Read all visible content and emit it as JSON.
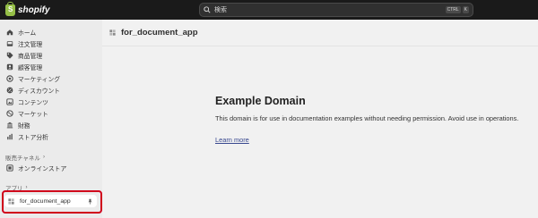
{
  "topbar": {
    "brand": "shopify",
    "search_placeholder": "検索",
    "shortcut_key1": "CTRL",
    "shortcut_key2": "K"
  },
  "sidebar": {
    "items": [
      {
        "label": "ホーム",
        "icon": "home-icon"
      },
      {
        "label": "注文管理",
        "icon": "inbox-icon"
      },
      {
        "label": "商品管理",
        "icon": "tag-icon"
      },
      {
        "label": "顧客管理",
        "icon": "person-icon"
      },
      {
        "label": "マーケティング",
        "icon": "target-icon"
      },
      {
        "label": "ディスカウント",
        "icon": "discount-icon"
      },
      {
        "label": "コンテンツ",
        "icon": "content-icon"
      },
      {
        "label": "マーケット",
        "icon": "globe-icon"
      },
      {
        "label": "財務",
        "icon": "bank-icon"
      },
      {
        "label": "ストア分析",
        "icon": "chart-icon"
      }
    ],
    "sales_channels_label": "販売チャネル",
    "online_store_label": "オンラインストア",
    "apps_label": "アプリ",
    "app_item_label": "for_document_app"
  },
  "main": {
    "page_title": "for_document_app",
    "heading": "Example Domain",
    "body_text": "This domain is for use in documentation examples without needing permission. Avoid use in operations.",
    "link_text": "Learn more"
  },
  "colors": {
    "topbar_bg": "#1a1a1a",
    "sidebar_bg": "#ebebeb",
    "main_bg": "#f1f1f1",
    "highlight": "#d0021b",
    "link": "#38488f",
    "brand_green": "#95bf47"
  }
}
